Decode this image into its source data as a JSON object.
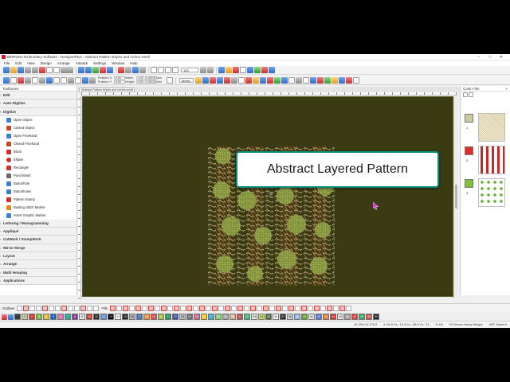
{
  "window": {
    "title": "BERNINA Embroidery Software - DesignerPlus - Abstract Pattern stripes and circles small",
    "minimize": "–",
    "maximize": "□",
    "close": "✕"
  },
  "menu": [
    "File",
    "Edit",
    "View",
    "Design",
    "Arrange",
    "Artwork",
    "Settings",
    "Window",
    "Help"
  ],
  "toolbar": {
    "position_x_label": "Position X:",
    "position_y_label": "Position Y:",
    "position_x": "0.00",
    "position_y": "0.00",
    "width_label": "Width:",
    "height_label": "Height:",
    "width": "0.00",
    "height": "0.00",
    "width_pct": "100.00",
    "height_pct": "100.00",
    "unit_w": "mm",
    "unit_h": "mm",
    "metric": "Metric",
    "zoom": "100"
  },
  "toolbox": {
    "header": "Toolboxes",
    "sections_top": [
      "Edit",
      "Auto-Digitize",
      "Digitize"
    ],
    "tools": [
      {
        "label": "Open Object",
        "color": "#3f7fd1"
      },
      {
        "label": "Closed Object",
        "color": "#c04a2a"
      },
      {
        "label": "Open Freehand",
        "color": "#3f7fd1"
      },
      {
        "label": "Closed Freehand",
        "color": "#c04a2a"
      },
      {
        "label": "Block",
        "color": "#cf3030"
      },
      {
        "label": "Ellipse",
        "color": "#cf3030"
      },
      {
        "label": "Rectangle",
        "color": "#cf3030"
      },
      {
        "label": "PunchWork",
        "color": "#6a6a6a"
      },
      {
        "label": "Buttonhole",
        "color": "#3f7fd1"
      },
      {
        "label": "Buttonholes",
        "color": "#3f7fd1"
      },
      {
        "label": "Pattern Stamp",
        "color": "#cf3030"
      },
      {
        "label": "Basting Stitch Marker",
        "color": "#e08a1c"
      },
      {
        "label": "Insert Graphic Marker",
        "color": "#3f7fd1"
      }
    ],
    "sections_bottom": [
      "Lettering / Monogramming",
      "Appliqué",
      "CutWork / StumpWork",
      "Mirror Merge",
      "Layout",
      "Arrange",
      "Multi Hooping",
      "Applications"
    ]
  },
  "document": {
    "tab_label": "Abstract Pattern stripes and circles small",
    "tab_close": "×",
    "callout": "Abstract Layered Pattern"
  },
  "color_film": {
    "header": "Color Film",
    "close": "×",
    "rows": [
      {
        "number": "1",
        "swatch": "#c9c9a4"
      },
      {
        "number": "2",
        "swatch": "#d92e2e"
      },
      {
        "number": "3",
        "swatch": "#7fbf3f"
      }
    ]
  },
  "bottom": {
    "outlines_label": "Outlines",
    "fills_label": "Fills",
    "palette": [
      {
        "label": "",
        "color": "#3a3a3a"
      },
      {
        "label": "1",
        "color": "#c9c9a4"
      },
      {
        "label": "2",
        "color": "#d92e2e"
      },
      {
        "label": "3",
        "color": "#7fbf3f"
      },
      {
        "label": "4",
        "color": "#e8c32b"
      },
      {
        "label": "5",
        "color": "#1c5ec7"
      },
      {
        "label": "6",
        "color": "#e26fa8"
      },
      {
        "label": "7",
        "color": "#24a9a0"
      },
      {
        "label": "8",
        "color": "#7a3e9d"
      },
      {
        "label": "9",
        "color": "#e4e4e4"
      },
      {
        "label": "10",
        "color": "#c0392b"
      },
      {
        "label": "11",
        "color": "#2b2b2b"
      },
      {
        "label": "12",
        "color": "#5a8fd6"
      },
      {
        "label": "13",
        "color": "#000000"
      },
      {
        "label": "14",
        "color": "#ffffff"
      },
      {
        "label": "15",
        "color": "#1f1f1f"
      },
      {
        "label": "16",
        "color": "#b3b3b3"
      },
      {
        "label": "17",
        "color": "#3d6fb5"
      },
      {
        "label": "18",
        "color": "#f08d2c"
      },
      {
        "label": "19",
        "color": "#e14141"
      },
      {
        "label": "20",
        "color": "#9bc13c"
      },
      {
        "label": "21",
        "color": "#1f8f5a"
      },
      {
        "label": "22",
        "color": "#2f4f9e"
      },
      {
        "label": "23",
        "color": "#bdbdbd"
      },
      {
        "label": "24",
        "color": "#6b6b6b"
      },
      {
        "label": "25",
        "color": "#d35d8f"
      },
      {
        "label": "26",
        "color": "#f0c419"
      },
      {
        "label": "27",
        "color": "#37a3d8"
      },
      {
        "label": "28",
        "color": "#7ccf6b"
      },
      {
        "label": "29",
        "color": "#a3a3a3"
      },
      {
        "label": "30",
        "color": "#d8b08c"
      },
      {
        "label": "31",
        "color": "#b84545"
      },
      {
        "label": "32",
        "color": "#3bb37a"
      },
      {
        "label": "33",
        "color": "#eaeaea"
      },
      {
        "label": "34",
        "color": "#c8e06a"
      },
      {
        "label": "35",
        "color": "#4a6a3a"
      },
      {
        "label": "36",
        "color": "#ffffff"
      },
      {
        "label": "37",
        "color": "#2c2c2c"
      },
      {
        "label": "38",
        "color": "#d6d6d6"
      },
      {
        "label": "39",
        "color": "#8fb4e0"
      },
      {
        "label": "40",
        "color": "#5e9e2f"
      },
      {
        "label": "41",
        "color": "#e6e6e6"
      },
      {
        "label": "42",
        "color": "#4f7bd1"
      },
      {
        "label": "43",
        "color": "#e07a2f"
      },
      {
        "label": "44",
        "color": "#cf2f2f"
      },
      {
        "label": "45",
        "color": "#f3f3f3"
      },
      {
        "label": "46",
        "color": "#9e9e9e"
      },
      {
        "label": "47",
        "color": "#e23b3b"
      },
      {
        "label": "48",
        "color": "#35a35a"
      },
      {
        "label": "49",
        "color": "#d84b4b"
      },
      {
        "label": "50",
        "color": "#1f1f1f"
      }
    ]
  },
  "status": {
    "size": "W 125.0  H 175.3",
    "xy": "X: 51.8 Ys: -13.3 Xs: -33.5 Ys: -74",
    "stitches": "S:110",
    "fabric": "Fil Woven Heavy Weight",
    "art": "ART Grade A"
  }
}
